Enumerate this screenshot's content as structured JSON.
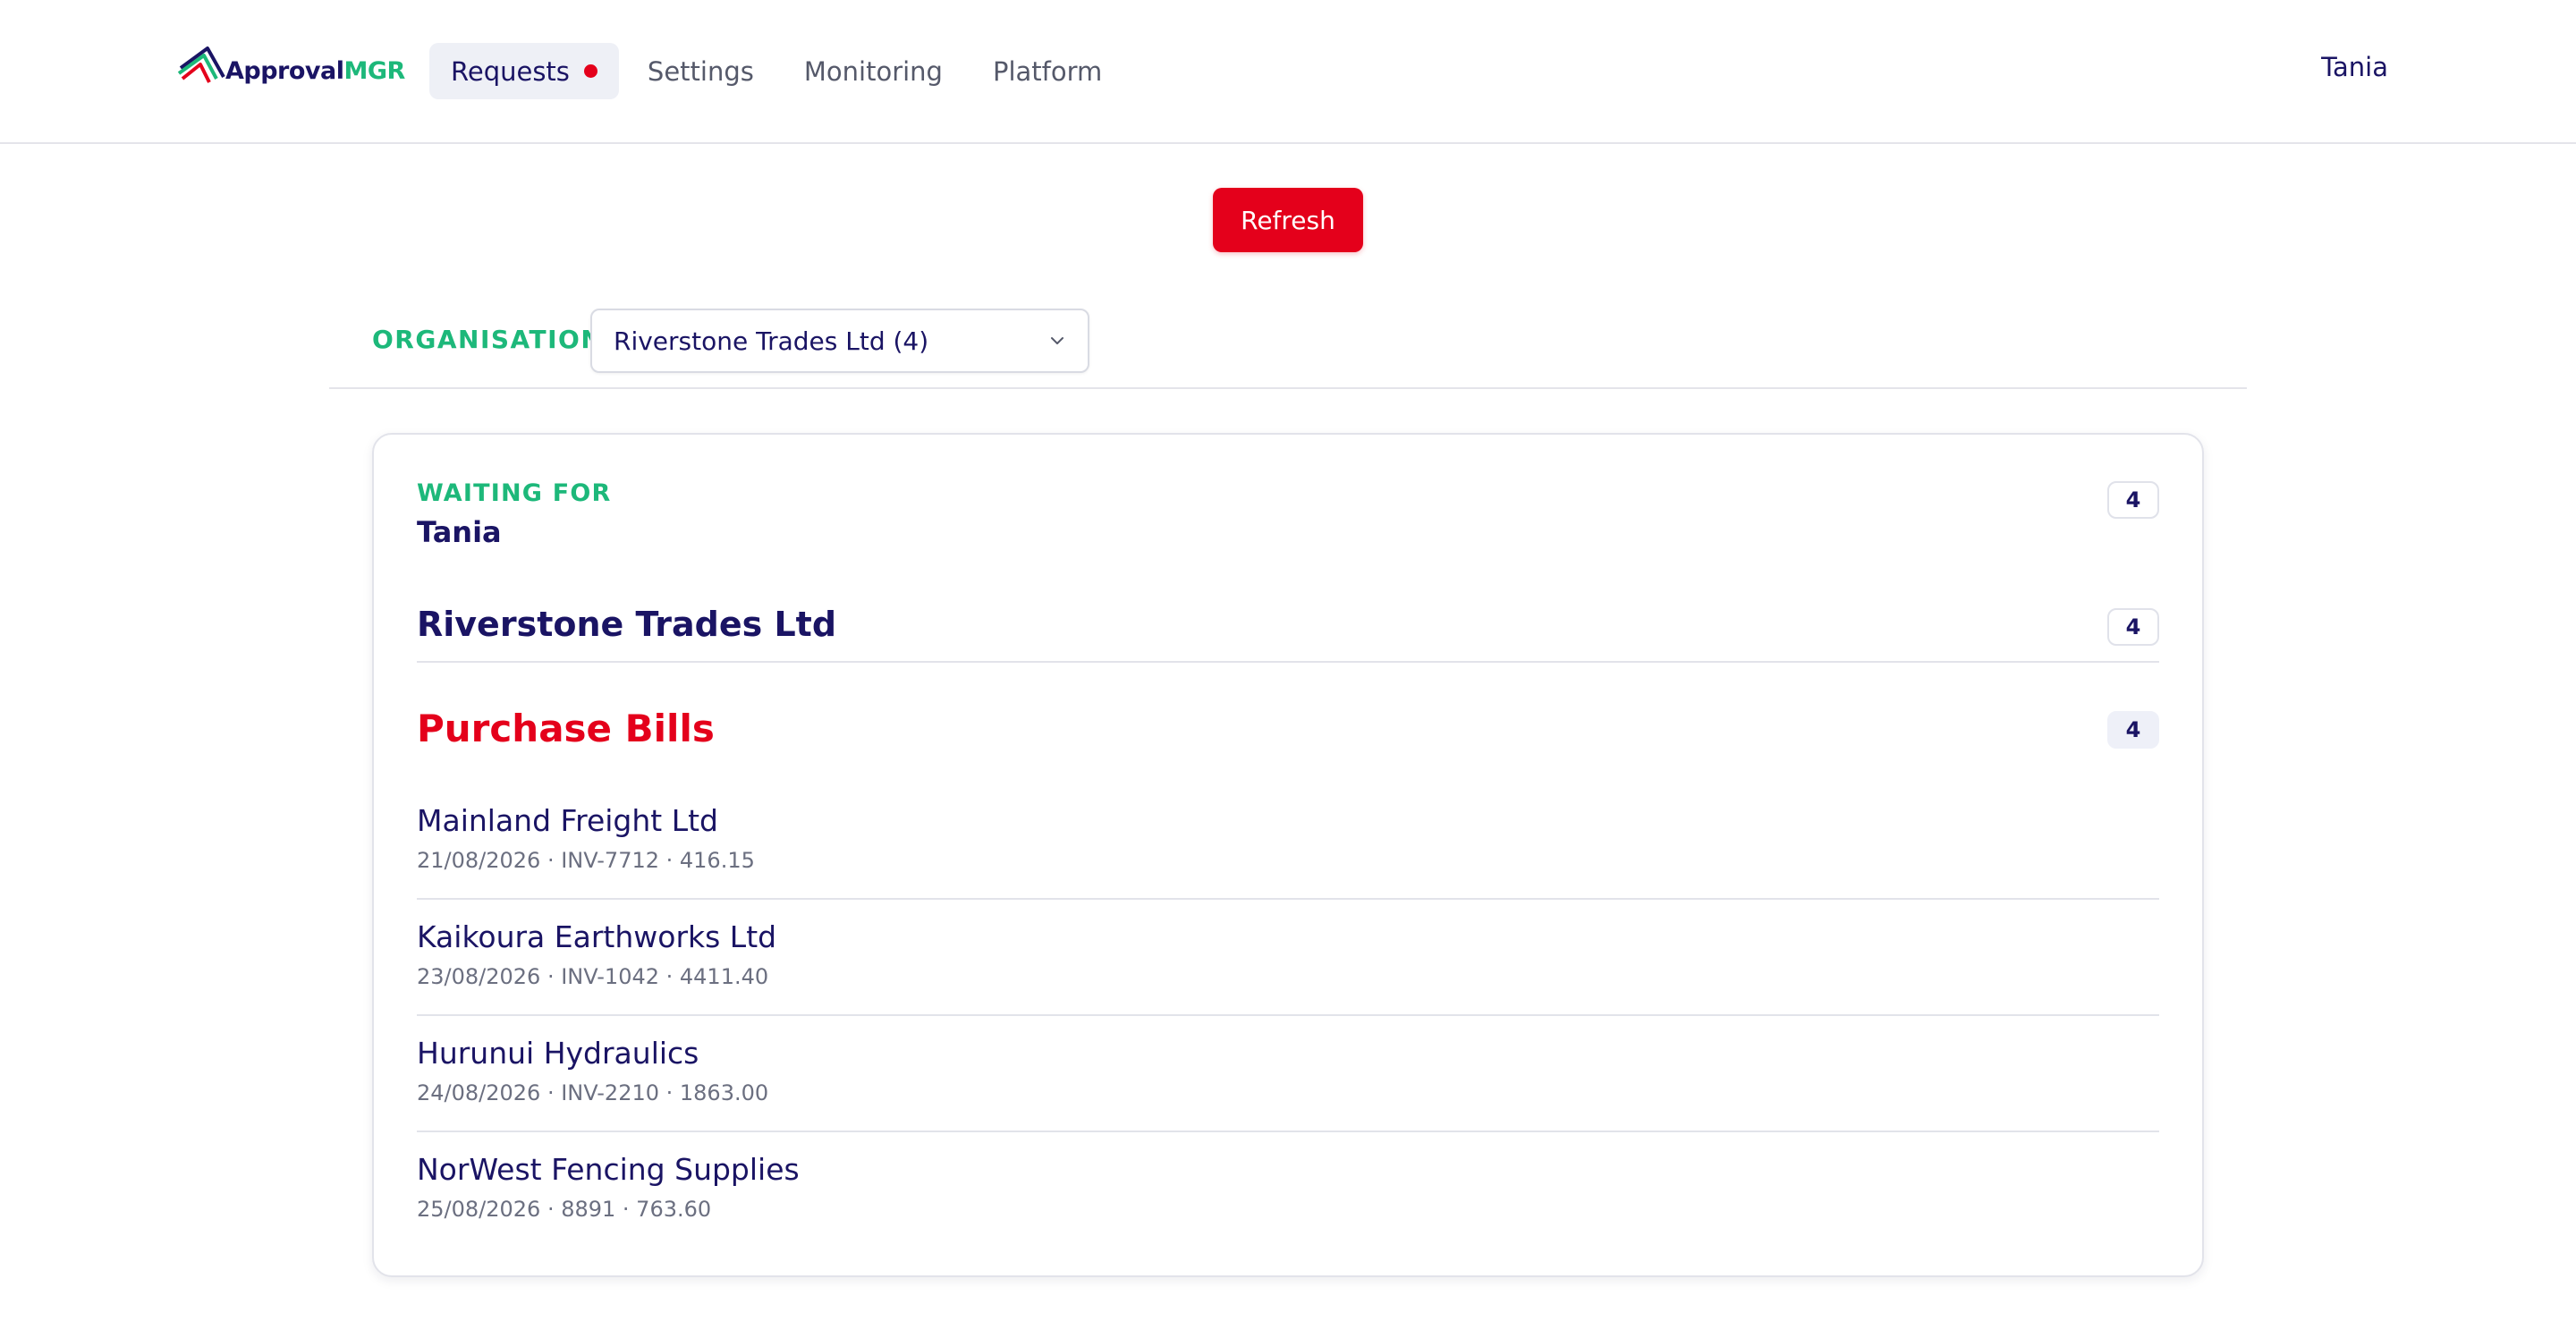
{
  "brand": {
    "name_part1": "Approval",
    "name_part2": "MGR",
    "primary_color": "#1a1464",
    "accent_color": "#1db87a",
    "alert_color": "#e4001b"
  },
  "nav": {
    "items": [
      {
        "label": "Requests",
        "active": true,
        "has_notification": true
      },
      {
        "label": "Settings"
      },
      {
        "label": "Monitoring"
      },
      {
        "label": "Platform"
      }
    ],
    "user": "Tania"
  },
  "toolbar": {
    "refresh_label": "Refresh"
  },
  "organisation": {
    "label": "ORGANISATION",
    "selected": "Riverstone Trades Ltd (4)"
  },
  "card": {
    "waiting_label": "WAITING FOR",
    "waiting_name": "Tania",
    "waiting_count": "4",
    "org_name": "Riverstone Trades Ltd",
    "org_count": "4",
    "section_title": "Purchase Bills",
    "section_count": "4",
    "bills": [
      {
        "supplier": "Mainland Freight Ltd",
        "meta": "21/08/2026 · INV-7712 · 416.15"
      },
      {
        "supplier": "Kaikoura Earthworks Ltd",
        "meta": "23/08/2026 · INV-1042 · 4411.40"
      },
      {
        "supplier": "Hurunui Hydraulics",
        "meta": "24/08/2026 · INV-2210 · 1863.00"
      },
      {
        "supplier": "NorWest Fencing Supplies",
        "meta": "25/08/2026 · 8891 · 763.60"
      }
    ]
  },
  "icons": {
    "logo": "approval-logo-mark",
    "dropdown": "chevron-down-icon",
    "notification": "notification-dot"
  }
}
